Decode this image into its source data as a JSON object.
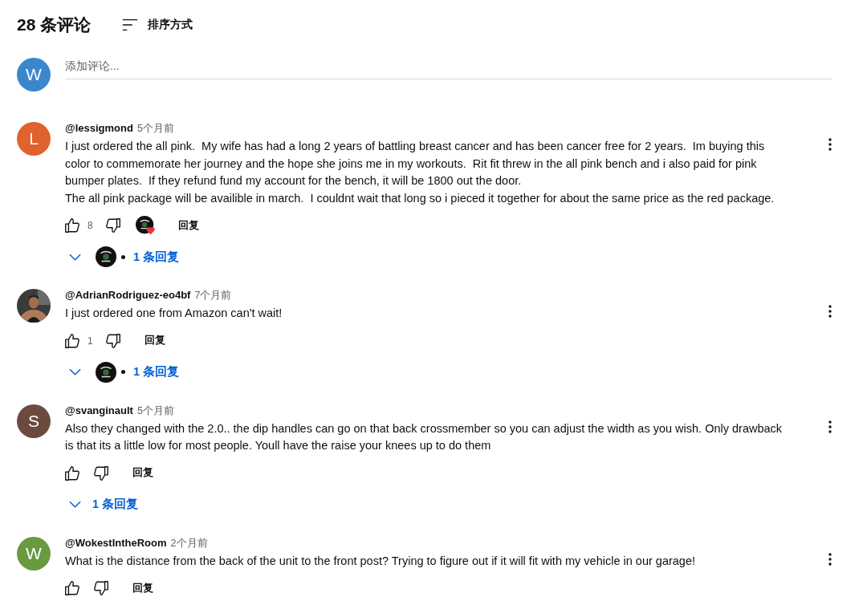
{
  "header": {
    "count": "28 条评论",
    "sort_label": "排序方式"
  },
  "composer": {
    "avatar_letter": "W",
    "placeholder": "添加评论..."
  },
  "comments": [
    {
      "avatar": {
        "kind": "letter",
        "letter": "L",
        "color": "#e0622e"
      },
      "author": "@lessigmond",
      "time": "5个月前",
      "lines": [
        "I just ordered the all pink.  My wife has had a long 2 years of battling breast cancer and has been cancer free for 2 years.  Im buying this",
        "color to commemorate her journey and the hope she joins me in my workouts.  Rit fit threw in the all pink bench and i also paid for pink",
        "bumper plates.  If they refund fund my account for the bench, it will be 1800 out the door.",
        "The all pink package will be availible in march.  I couldnt wait that long so i pieced it together for about the same price as the red package."
      ],
      "likes": "8",
      "creator_heart": true,
      "reply_label": "回复",
      "replies": "1 条回复",
      "reply_avatar": true
    },
    {
      "avatar": {
        "kind": "picture"
      },
      "author": "@AdrianRodriguez-eo4bf",
      "time": "7个月前",
      "lines": [
        "I just ordered one from Amazon can't wait!"
      ],
      "likes": "1",
      "creator_heart": false,
      "reply_label": "回复",
      "replies": "1 条回复",
      "reply_avatar": true
    },
    {
      "avatar": {
        "kind": "letter",
        "letter": "S",
        "color": "#6d4a3f"
      },
      "author": "@svanginault",
      "time": "5个月前",
      "lines": [
        "Also they changed with the 2.0.. the dip handles can go on that back crossmember so you can adjust the width as you wish. Only drawback",
        "is that its a little low for most people. Youll have the raise your knees up to do them"
      ],
      "creator_heart": false,
      "reply_label": "回复",
      "replies": "1 条回复",
      "reply_avatar": false
    },
    {
      "avatar": {
        "kind": "letter",
        "letter": "W",
        "color": "#6a9a3f"
      },
      "author": "@WokestIntheRoom",
      "time": "2个月前",
      "lines": [
        "What is the distance from the back of the unit to the front post? Trying to figure out if it will fit with my vehicle in our garage!"
      ],
      "creator_heart": false,
      "reply_label": "回复"
    }
  ]
}
